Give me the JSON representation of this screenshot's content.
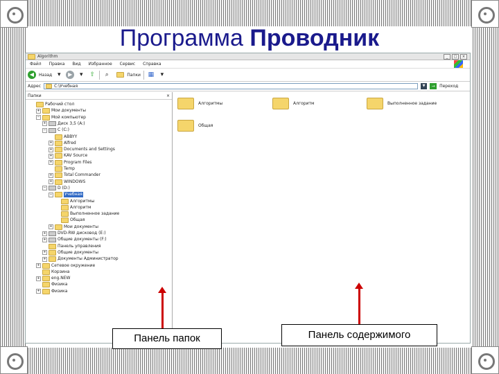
{
  "slide": {
    "title_regular": "Программа",
    "title_bold": "Проводник"
  },
  "window": {
    "title": "Algorithm",
    "menu": [
      "Файл",
      "Правка",
      "Вид",
      "Избранное",
      "Сервис",
      "Справка"
    ],
    "toolbar": {
      "back": "Назад",
      "folders": "Папки"
    },
    "address": {
      "label": "Адрес",
      "value": "C:\\Учебная",
      "go": "Переход"
    },
    "folders_pane": {
      "title": "Папки",
      "tree": [
        {
          "label": "Рабочий стол",
          "level": 0,
          "kind": "folder",
          "toggle": ""
        },
        {
          "label": "Мои документы",
          "level": 1,
          "kind": "folder",
          "toggle": "+"
        },
        {
          "label": "Мой компьютер",
          "level": 1,
          "kind": "folder",
          "toggle": "−"
        },
        {
          "label": "Диск 3,5 (A:)",
          "level": 2,
          "kind": "drive",
          "toggle": "+"
        },
        {
          "label": "C (C:)",
          "level": 2,
          "kind": "drive",
          "toggle": "−"
        },
        {
          "label": "ABBYY",
          "level": 3,
          "kind": "folder",
          "toggle": ""
        },
        {
          "label": "Alfred",
          "level": 3,
          "kind": "folder",
          "toggle": "+"
        },
        {
          "label": "Documents and Settings",
          "level": 3,
          "kind": "folder",
          "toggle": "+"
        },
        {
          "label": "KAV Source",
          "level": 3,
          "kind": "folder",
          "toggle": "+"
        },
        {
          "label": "Program Files",
          "level": 3,
          "kind": "folder",
          "toggle": "+"
        },
        {
          "label": "Temp",
          "level": 3,
          "kind": "folder",
          "toggle": ""
        },
        {
          "label": "Total Commander",
          "level": 3,
          "kind": "folder",
          "toggle": "+"
        },
        {
          "label": "WINDOWS",
          "level": 3,
          "kind": "folder",
          "toggle": "+"
        },
        {
          "label": "D (D:)",
          "level": 2,
          "kind": "drive",
          "toggle": "−"
        },
        {
          "label": "Учебная",
          "level": 3,
          "kind": "folder",
          "toggle": "−",
          "selected": true
        },
        {
          "label": "Алгоритмы",
          "level": 4,
          "kind": "folder",
          "toggle": ""
        },
        {
          "label": "Алгоритм",
          "level": 4,
          "kind": "folder",
          "toggle": ""
        },
        {
          "label": "Выполненное задание",
          "level": 4,
          "kind": "folder",
          "toggle": ""
        },
        {
          "label": "Общая",
          "level": 4,
          "kind": "folder",
          "toggle": ""
        },
        {
          "label": "Мои документы",
          "level": 3,
          "kind": "folder",
          "toggle": "+"
        },
        {
          "label": "DVD-RW дисковод (E:)",
          "level": 2,
          "kind": "drive",
          "toggle": "+"
        },
        {
          "label": "Общие документы (F:)",
          "level": 2,
          "kind": "drive",
          "toggle": "+"
        },
        {
          "label": "Панель управления",
          "level": 2,
          "kind": "folder",
          "toggle": ""
        },
        {
          "label": "Общие документы",
          "level": 2,
          "kind": "folder",
          "toggle": "+"
        },
        {
          "label": "Документы Администратор",
          "level": 2,
          "kind": "folder",
          "toggle": "+"
        },
        {
          "label": "Сетевое окружение",
          "level": 1,
          "kind": "folder",
          "toggle": "+"
        },
        {
          "label": "Корзина",
          "level": 1,
          "kind": "folder",
          "toggle": ""
        },
        {
          "label": "eng.NEW",
          "level": 1,
          "kind": "folder",
          "toggle": "+"
        },
        {
          "label": "Физика",
          "level": 1,
          "kind": "folder",
          "toggle": ""
        },
        {
          "label": "Физика",
          "level": 1,
          "kind": "folder",
          "toggle": "+"
        }
      ]
    },
    "content_items": [
      "Алгоритмы",
      "Алгоритм",
      "Выполненное задание",
      "Общая"
    ]
  },
  "callouts": {
    "folders_pane": "Панель папок",
    "content_pane": "Панель содержимого"
  },
  "colors": {
    "title": "#1a1a8c",
    "arrow": "#cc0000",
    "selection": "#316ac5"
  }
}
